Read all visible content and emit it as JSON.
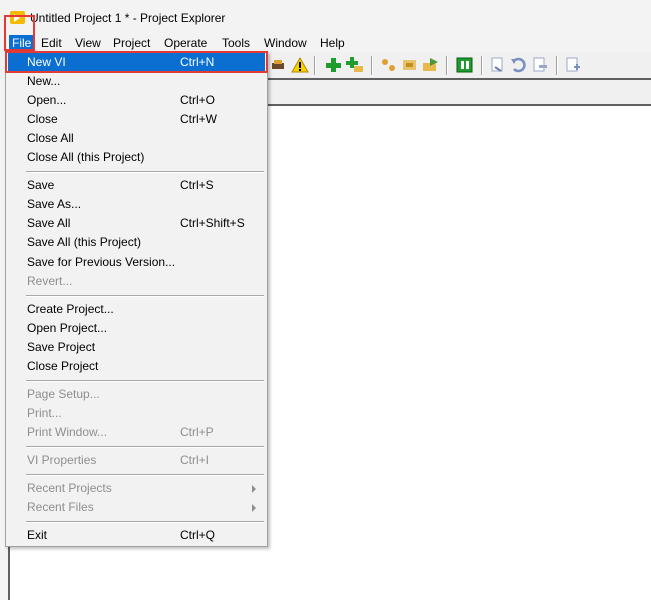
{
  "window": {
    "title": "Untitled Project 1 * - Project Explorer",
    "icon": "labview-project-icon"
  },
  "menubar": {
    "items": [
      "File",
      "Edit",
      "View",
      "Project",
      "Operate",
      "Tools",
      "Window",
      "Help"
    ],
    "active": "File"
  },
  "toolbar": {
    "icons": [
      "warning-icon",
      "add-icon",
      "add-folder-icon",
      "build-icon",
      "build-all-icon",
      "deploy-icon",
      "target-icon",
      "undo-icon",
      "redo-icon",
      "properties-icon",
      "new-vi-icon"
    ]
  },
  "file_menu": {
    "groups": [
      [
        {
          "label": "New VI",
          "shortcut": "Ctrl+N",
          "selected": true
        },
        {
          "label": "New...",
          "shortcut": ""
        },
        {
          "label": "Open...",
          "shortcut": "Ctrl+O"
        },
        {
          "label": "Close",
          "shortcut": "Ctrl+W"
        },
        {
          "label": "Close All",
          "shortcut": ""
        },
        {
          "label": "Close All (this Project)",
          "shortcut": ""
        }
      ],
      [
        {
          "label": "Save",
          "shortcut": "Ctrl+S"
        },
        {
          "label": "Save As...",
          "shortcut": ""
        },
        {
          "label": "Save All",
          "shortcut": "Ctrl+Shift+S"
        },
        {
          "label": "Save All (this Project)",
          "shortcut": ""
        },
        {
          "label": "Save for Previous Version...",
          "shortcut": ""
        },
        {
          "label": "Revert...",
          "shortcut": "",
          "disabled": true
        }
      ],
      [
        {
          "label": "Create Project...",
          "shortcut": ""
        },
        {
          "label": "Open Project...",
          "shortcut": ""
        },
        {
          "label": "Save Project",
          "shortcut": ""
        },
        {
          "label": "Close Project",
          "shortcut": ""
        }
      ],
      [
        {
          "label": "Page Setup...",
          "shortcut": "",
          "disabled": true
        },
        {
          "label": "Print...",
          "shortcut": "",
          "disabled": true
        },
        {
          "label": "Print Window...",
          "shortcut": "Ctrl+P",
          "disabled": true
        }
      ],
      [
        {
          "label": "VI Properties",
          "shortcut": "Ctrl+I",
          "disabled": true
        }
      ],
      [
        {
          "label": "Recent Projects",
          "shortcut": "",
          "disabled": true,
          "submenu": true
        },
        {
          "label": "Recent Files",
          "shortcut": "",
          "disabled": true,
          "submenu": true
        }
      ],
      [
        {
          "label": "Exit",
          "shortcut": "Ctrl+Q"
        }
      ]
    ]
  },
  "colors": {
    "selection": "#0a6fd1",
    "highlight_box": "#e53935",
    "disabled_text": "#8e8e8e"
  }
}
